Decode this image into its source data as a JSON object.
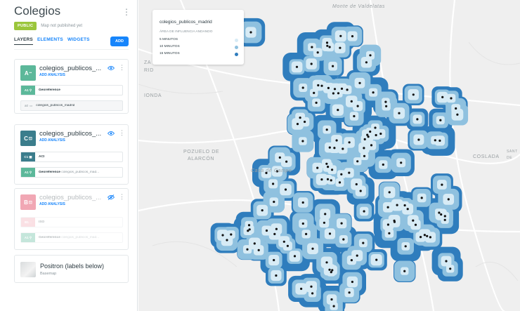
{
  "sidebar": {
    "map_title": "Colegios",
    "status_badge": "PUBLIC",
    "publish_status": "Map not published yet",
    "tabs": [
      "LAYERS",
      "ELEMENTS",
      "WIDGETS"
    ],
    "add_label": "ADD",
    "layers": [
      {
        "badge": "A",
        "badge_color": "#5cb89a",
        "name": "colegios_publicos_...",
        "sub": "ADD ANALYSIS",
        "nodes": [
          {
            "chip": "A1",
            "label": "Georeference",
            "extra": ""
          }
        ],
        "source": {
          "id": "a0",
          "table": "colegios_publicos_madrid"
        }
      },
      {
        "badge": "C",
        "badge_color": "#3b7d8c",
        "name": "colegios_publicos_...",
        "sub": "ADD ANALYSIS",
        "nodes": [
          {
            "chip": "C1",
            "label": "ACI",
            "extra": ""
          },
          {
            "chip": "A1",
            "label": "Georeference",
            "extra": "colegios_publicos_mad..."
          }
        ]
      },
      {
        "badge": "B",
        "badge_color": "#f1a7b4",
        "name": "colegios_publicos_...",
        "sub": "ADD ANALYSIS",
        "nodes": [
          {
            "chip": "B1",
            "label": "ISO",
            "extra": ""
          },
          {
            "chip": "A1",
            "label": "Georeference",
            "extra": "colegios_publicos_mad..."
          }
        ]
      }
    ],
    "basemap": {
      "name": "Positron (labels below)",
      "type": "Basemap"
    }
  },
  "map": {
    "places": [
      "Monte de Valdelatas",
      "ZA",
      "RID",
      "IONDA",
      "POZUELO DE",
      "ALARCÓN",
      "Casa de Campo",
      "COSLADA",
      "SANT",
      "DE"
    ],
    "legend": {
      "title": "colegios_publicos_madrid",
      "subtitle": "ÁREA DE INFLUENCIA ANDANDO",
      "items": [
        {
          "label": "5 MINUTOS",
          "color": "#d7ebf5"
        },
        {
          "label": "10 MINUTOS",
          "color": "#8fc1df"
        },
        {
          "label": "15 MINUTOS",
          "color": "#2f7dbd"
        }
      ]
    },
    "colors": {
      "outer": "#2f7dbd",
      "mid": "#8fc1df",
      "inner": "#d7ebf5",
      "point": "#111111"
    }
  }
}
